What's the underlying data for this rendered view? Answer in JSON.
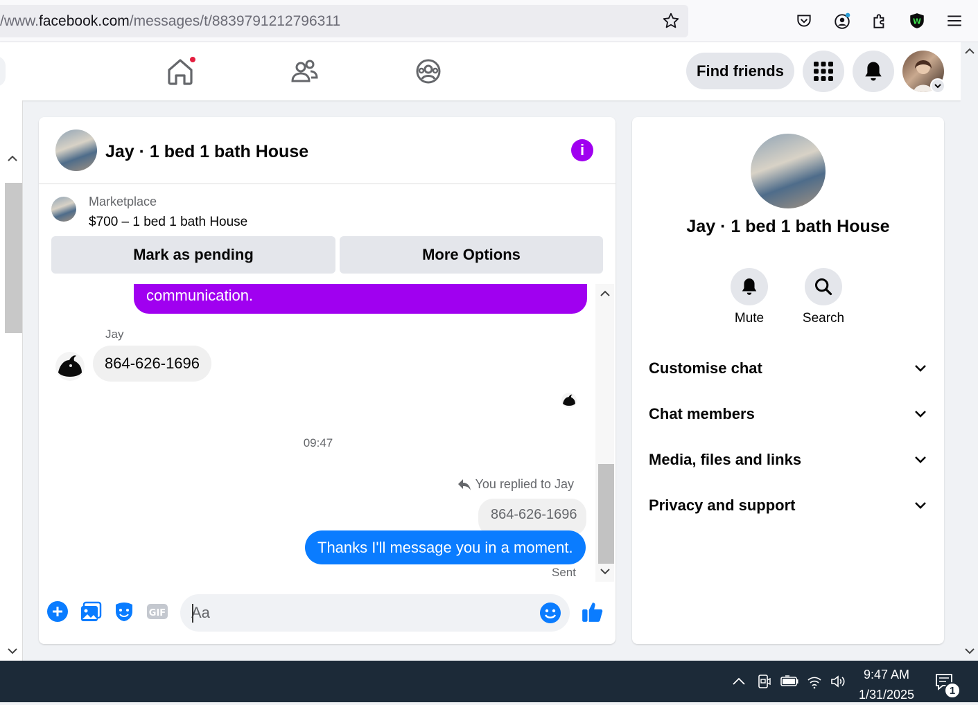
{
  "browser": {
    "url_prefix": "/www.",
    "url_domain": "facebook.com",
    "url_path": "/messages/t/8839791212796311"
  },
  "header": {
    "find_friends_label": "Find friends"
  },
  "chat": {
    "title": "Jay · 1 bed 1 bath House",
    "marketplace_label": "Marketplace",
    "listing": "$700 – 1 bed 1 bath House",
    "mark_pending_label": "Mark as pending",
    "more_options_label": "More Options",
    "messages": {
      "outgoing_partial": "communication.",
      "sender_name": "Jay",
      "incoming_text": "864-626-1696",
      "timestamp": "09:47",
      "replied_label": "You replied to Jay",
      "quoted_text": "864-626-1696",
      "outgoing_text": "Thanks I'll message you in a moment.",
      "status": "Sent"
    },
    "composer": {
      "placeholder": "Aa",
      "accent_color": "#0a7cff"
    }
  },
  "details": {
    "title": "Jay · 1 bed 1 bath House",
    "mute_label": "Mute",
    "search_label": "Search",
    "sections": [
      "Customise chat",
      "Chat members",
      "Media, files and links",
      "Privacy and support"
    ]
  },
  "taskbar": {
    "time": "9:47 AM",
    "date": "1/31/2025",
    "notification_count": "1"
  },
  "colors": {
    "messenger_purple": "#a000f0",
    "messenger_blue": "#0a7cff",
    "fb_gray": "#e4e6eb"
  }
}
